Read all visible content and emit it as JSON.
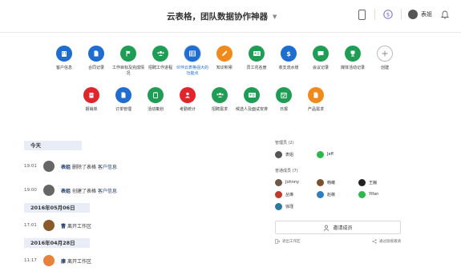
{
  "header": {
    "title": "云表格，团队数据协作神器",
    "user_name": "表姐"
  },
  "apps_row1": [
    {
      "label": "客户信息",
      "icon": "building-icon",
      "color": "#1f6dd0"
    },
    {
      "label": "合同记录",
      "icon": "document-icon",
      "color": "#1f6dd0"
    },
    {
      "label": "工作目标及完成情况",
      "icon": "flag-icon",
      "color": "#1f9d55"
    },
    {
      "label": "招聘工作进程",
      "icon": "team-icon",
      "color": "#1f9d55"
    },
    {
      "label": "伙伴云表格强大的功能点",
      "icon": "table-icon",
      "color": "#1f6dd0"
    },
    {
      "label": "知识积累",
      "icon": "pencil-icon",
      "color": "#f08a1c"
    },
    {
      "label": "员工花名册",
      "icon": "id-card-icon",
      "color": "#1f9d55"
    },
    {
      "label": "收支流水账",
      "icon": "dollar-icon",
      "color": "#1f6dd0"
    },
    {
      "label": "会议记录",
      "icon": "chat-icon",
      "color": "#1f9d55"
    },
    {
      "label": "媒体活动记录",
      "icon": "trophy-icon",
      "color": "#1f9d55"
    },
    {
      "label": "创建",
      "icon": "plus-icon",
      "color": "#ffffff"
    }
  ],
  "apps_row2": [
    {
      "label": "报销单",
      "icon": "receipt-icon",
      "color": "#e0252b"
    },
    {
      "label": "订单管理",
      "icon": "document-icon",
      "color": "#1f6dd0"
    },
    {
      "label": "活动策划",
      "icon": "clipboard-icon",
      "color": "#1f9d55"
    },
    {
      "label": "考勤统计",
      "icon": "person-icon",
      "color": "#e0252b"
    },
    {
      "label": "招聘需求",
      "icon": "team-icon",
      "color": "#1f9d55"
    },
    {
      "label": "候选人及面试安排",
      "icon": "id-card-icon",
      "color": "#1f9d55"
    },
    {
      "label": "日报",
      "icon": "calendar-icon",
      "color": "#1f9d55"
    },
    {
      "label": "产品需求",
      "icon": "document-icon",
      "color": "#f08a1c"
    }
  ],
  "feed": {
    "day1": "今天",
    "items_day1": [
      {
        "time": "19:01",
        "user": "表姐",
        "action": "删除了表格",
        "target": "客户信息"
      },
      {
        "time": "19:00",
        "user": "表姐",
        "action": "创建了表格",
        "target": "客户信息"
      }
    ],
    "day2": "2016年05月06日",
    "item_day2": {
      "time": "17:01",
      "user": "曹",
      "action": "离开工作区"
    },
    "day3": "2016年04月28日",
    "item_day3": {
      "time": "11:17",
      "user": "康",
      "action": "离开工作区"
    }
  },
  "panel": {
    "admins_head": "管理员 (2)",
    "admins": [
      {
        "name": "表姐",
        "color": "#555555"
      },
      {
        "name": "Jeff",
        "color": "#2db84d"
      }
    ],
    "members_head": "普通成员 (7)",
    "members": [
      {
        "name": "Johnny",
        "color": "#6b5a4a"
      },
      {
        "name": "韩曦",
        "color": "#7a5230"
      },
      {
        "name": "王巍",
        "color": "#222222"
      },
      {
        "name": "丛琳",
        "color": "#c0392b"
      },
      {
        "name": "赵薇",
        "color": "#2d7fc1"
      },
      {
        "name": "Yifan",
        "color": "#2db84d"
      },
      {
        "name": "徐瑾",
        "color": "#2b7a9b"
      }
    ],
    "invite_label": "邀请成员",
    "exit_label": "退出工作区",
    "link_invite_label": "通过链接邀请"
  }
}
